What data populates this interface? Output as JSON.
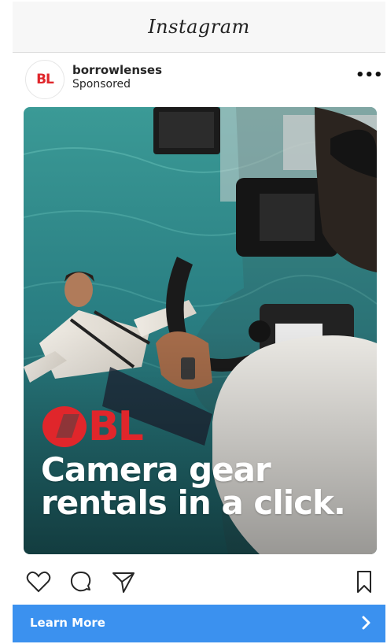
{
  "app": {
    "title": "Instagram"
  },
  "post": {
    "account_name": "borrowlenses",
    "account_subtitle": "Sponsored",
    "avatar_text": "BL",
    "more_label": "•••"
  },
  "ad_image": {
    "logo_text": "BL",
    "headline_line1": "Camera gear",
    "headline_line2": "rentals in a click."
  },
  "actions": {
    "like_icon": "heart-icon",
    "comment_icon": "comment-icon",
    "share_icon": "send-icon",
    "save_icon": "bookmark-icon"
  },
  "cta": {
    "label": "Learn More",
    "icon": "chevron-right-icon"
  },
  "colors": {
    "brand_red": "#e0262b",
    "cta_blue": "#3b91ef",
    "pool_teal": "#2a7f83"
  }
}
